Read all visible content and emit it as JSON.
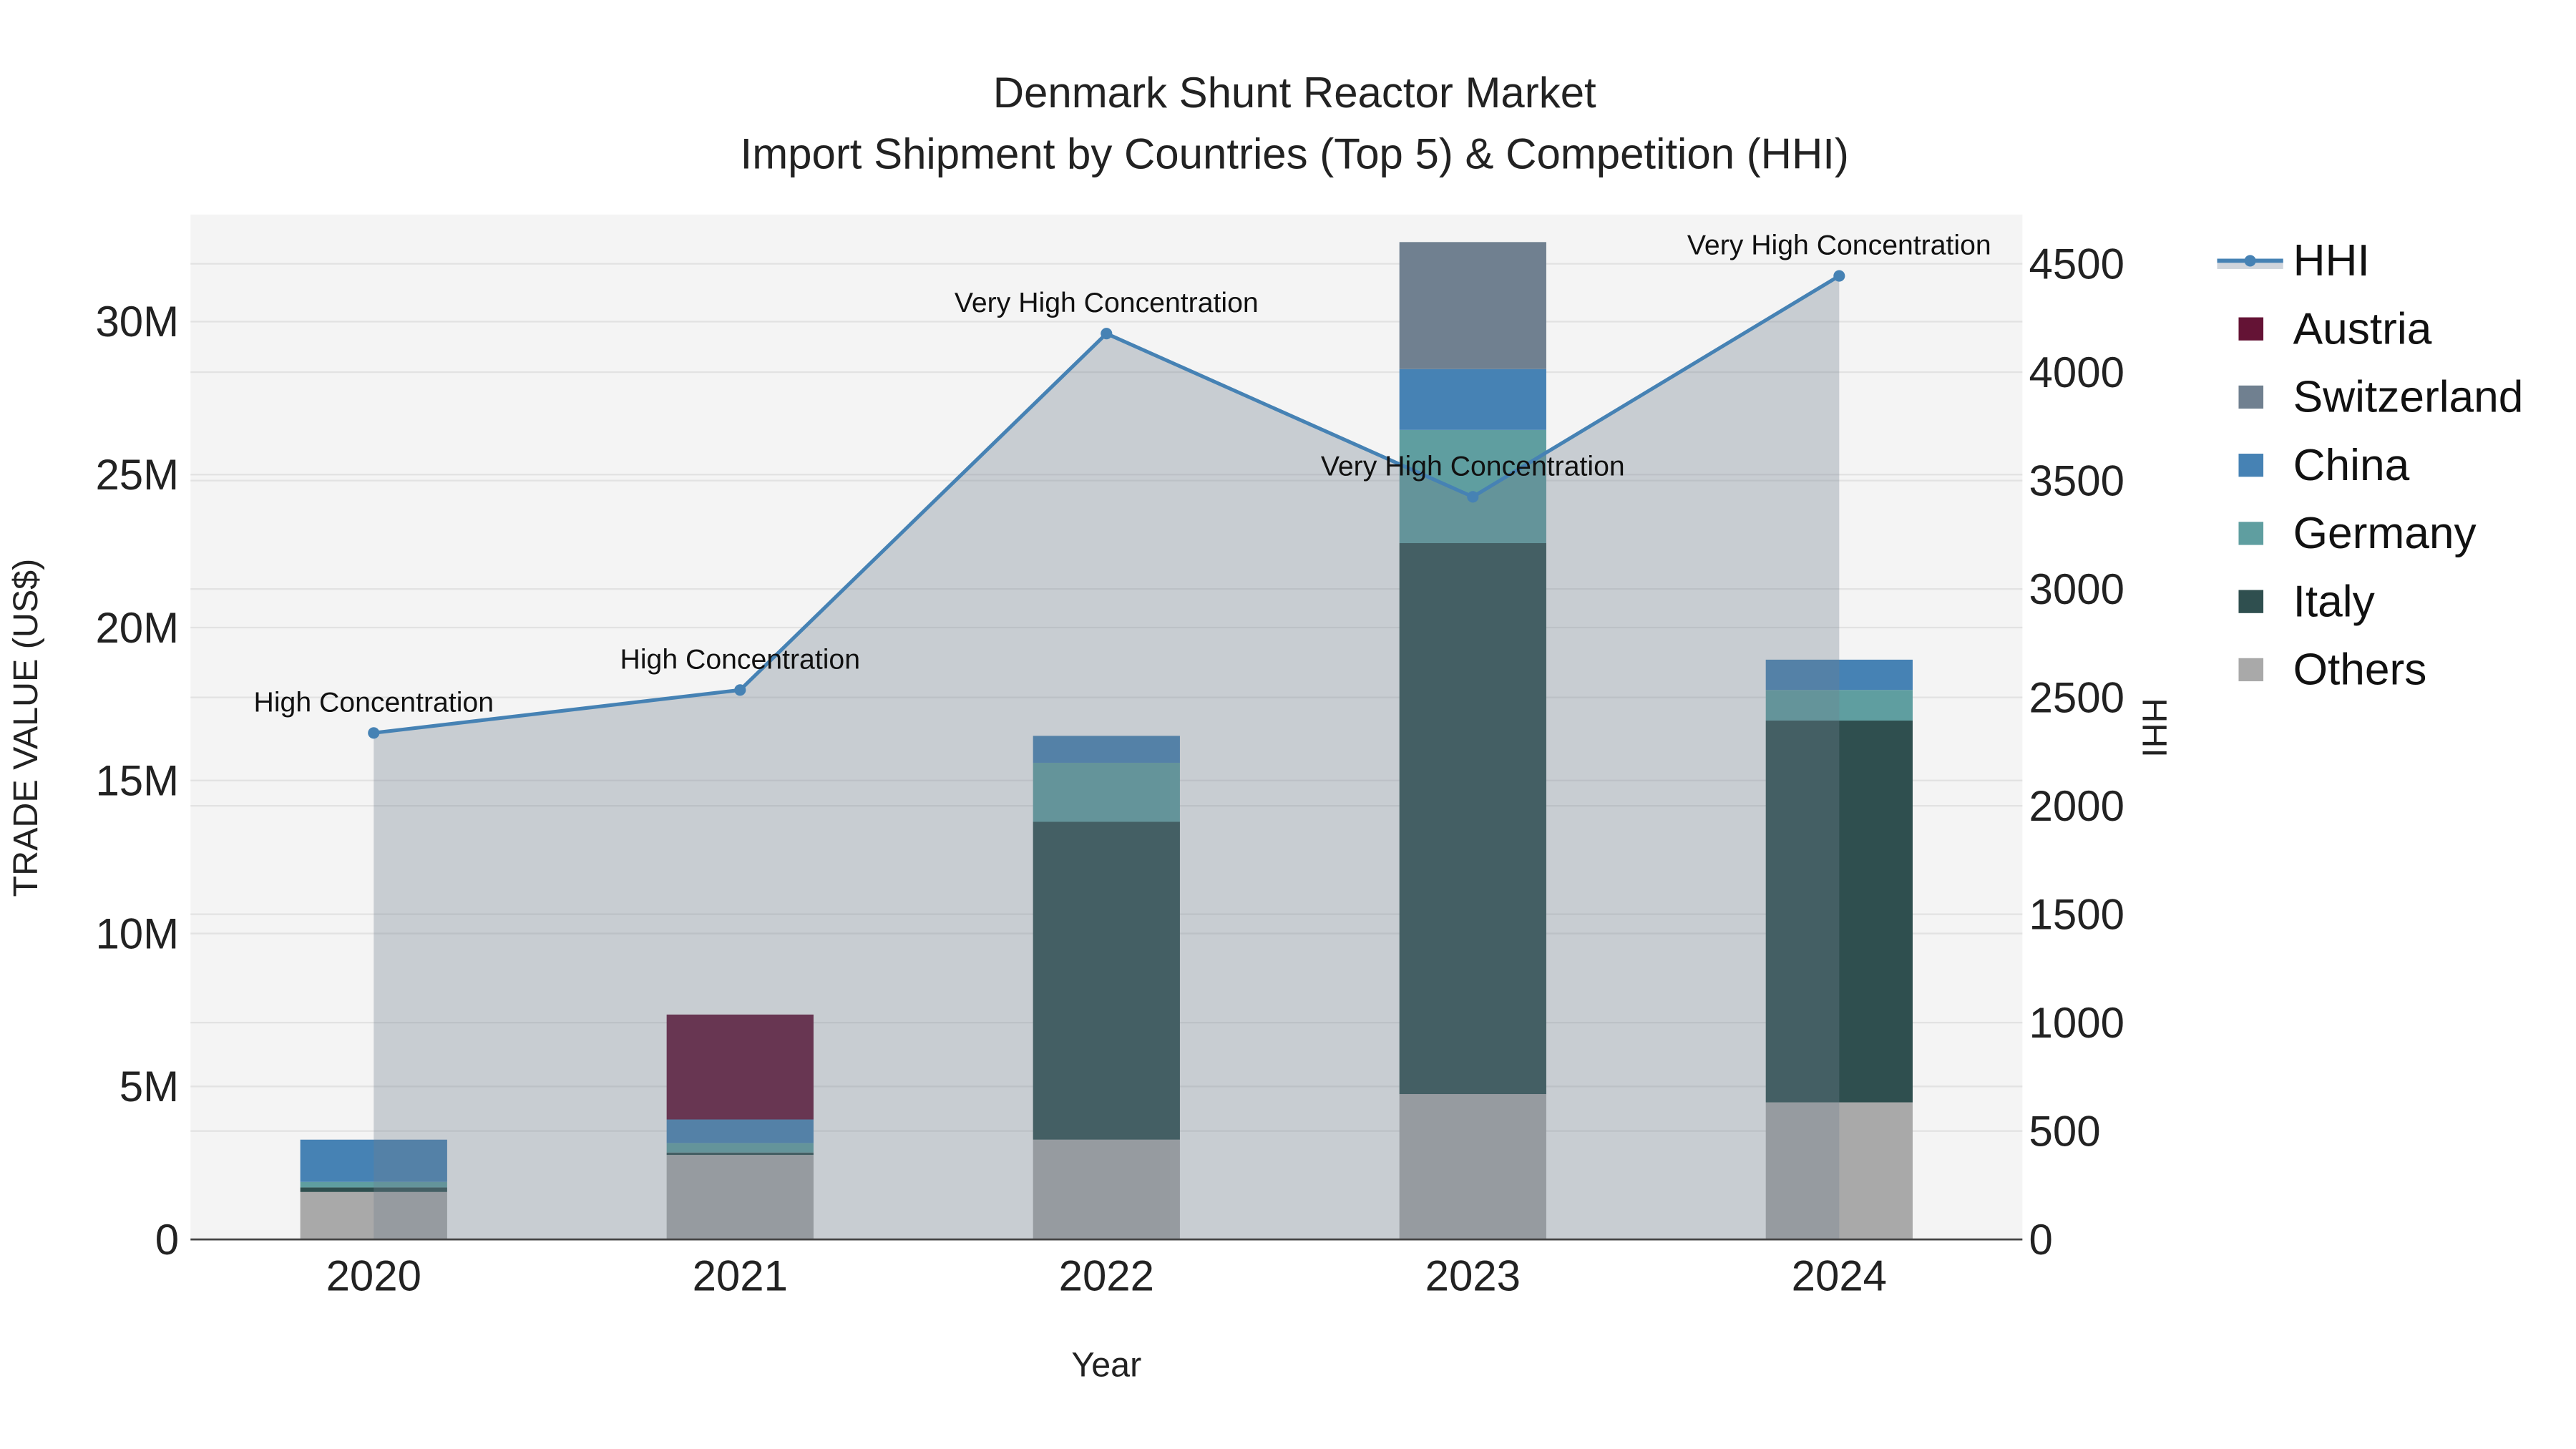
{
  "chart_data": {
    "type": "bar",
    "title": "Denmark Shunt Reactor Market",
    "subtitle": "Import Shipment by Countries (Top 5) & Competition (HHI)",
    "xlabel": "Year",
    "ylabel": "TRADE VALUE (US$)",
    "y2label": "HHI",
    "categories": [
      "2020",
      "2021",
      "2022",
      "2023",
      "2024"
    ],
    "ylim": [
      0,
      33500000
    ],
    "y_ticks": [
      0,
      5000000,
      10000000,
      15000000,
      20000000,
      25000000,
      30000000
    ],
    "y_tick_labels": [
      "0",
      "5M",
      "10M",
      "15M",
      "20M",
      "25M",
      "30M"
    ],
    "y2lim": [
      0,
      4727
    ],
    "y2_ticks": [
      0,
      500,
      1000,
      1500,
      2000,
      2500,
      3000,
      3500,
      4000,
      4500
    ],
    "y2_tick_labels": [
      "0",
      "500",
      "1000",
      "1500",
      "2000",
      "2500",
      "3000",
      "3500",
      "4000",
      "4500"
    ],
    "grid": true,
    "legend_position": "right",
    "series": [
      {
        "name": "Others",
        "color": "#A9A9A9",
        "values": [
          1550000,
          2760000,
          3260000,
          4750000,
          4480000
        ]
      },
      {
        "name": "Italy",
        "color": "#2F4F4F",
        "values": [
          150000,
          80000,
          10390000,
          18010000,
          12480000
        ]
      },
      {
        "name": "Germany",
        "color": "#5F9EA0",
        "values": [
          180000,
          310000,
          1930000,
          3700000,
          1000000
        ]
      },
      {
        "name": "China",
        "color": "#4682B4",
        "values": [
          1380000,
          770000,
          880000,
          1990000,
          990000
        ]
      },
      {
        "name": "Switzerland",
        "color": "#708090",
        "values": [
          0,
          0,
          0,
          4150000,
          0
        ]
      },
      {
        "name": "Austria",
        "color": "#641335",
        "values": [
          0,
          3430000,
          0,
          0,
          0
        ]
      }
    ],
    "legend_order": [
      "HHI",
      "Austria",
      "Switzerland",
      "China",
      "Germany",
      "Italy",
      "Others"
    ],
    "hhi": {
      "name": "HHI",
      "color": "#4682B4",
      "values": [
        2336,
        2534,
        4178,
        3425,
        4444
      ],
      "annotations": [
        "High Concentration",
        "High Concentration",
        "Very High Concentration",
        "Very High Concentration",
        "Very High Concentration"
      ]
    }
  }
}
